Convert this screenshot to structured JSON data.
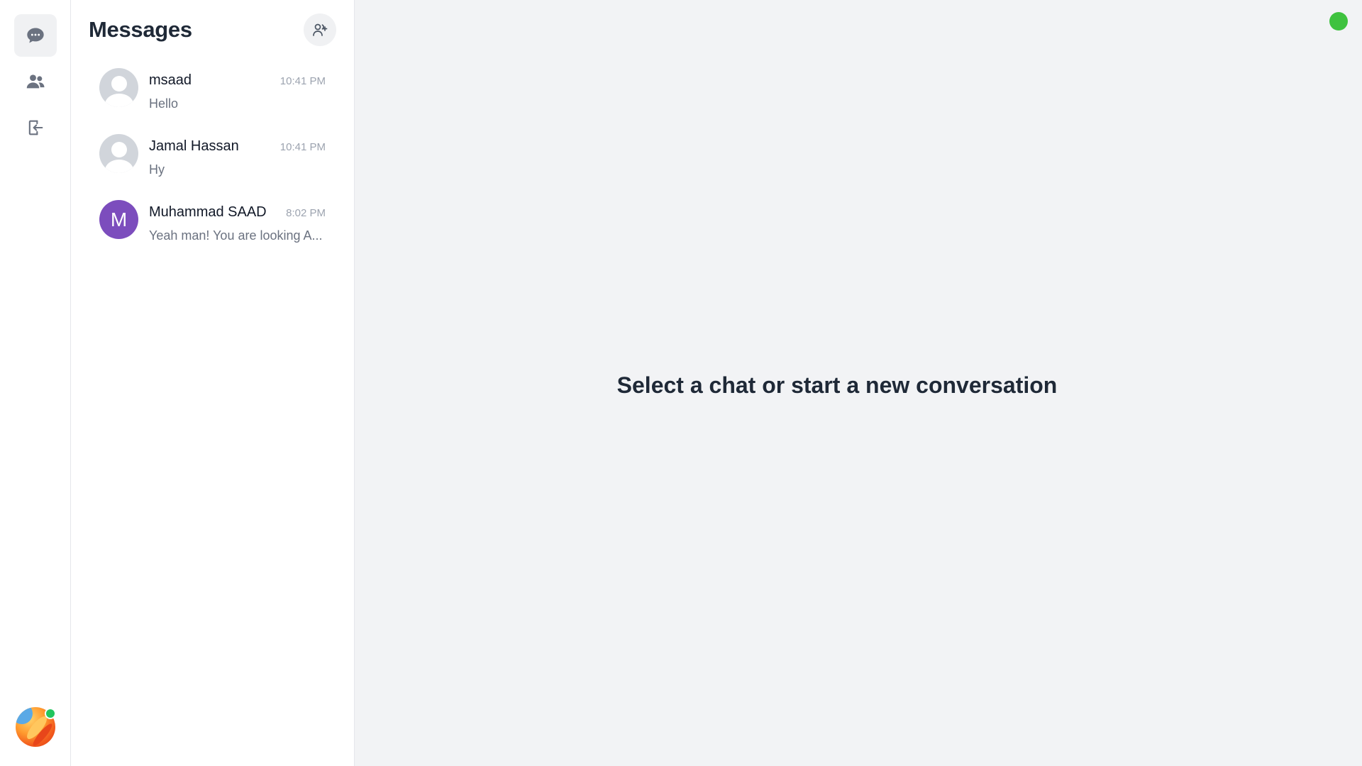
{
  "nav": {
    "items": [
      {
        "name": "chats",
        "icon": "chat-bubble-icon",
        "active": true
      },
      {
        "name": "contacts",
        "icon": "users-icon",
        "active": false
      },
      {
        "name": "logout",
        "icon": "logout-icon",
        "active": false
      }
    ],
    "user_status": "online"
  },
  "messages_panel": {
    "title": "Messages",
    "add_contact_icon": "user-plus-icon",
    "chats": [
      {
        "name": "msaad",
        "time": "10:41 PM",
        "preview": "Hello",
        "avatar": "default"
      },
      {
        "name": "Jamal Hassan",
        "time": "10:41 PM",
        "preview": "Hy",
        "avatar": "default"
      },
      {
        "name": "Muhammad SAAD",
        "time": "8:02 PM",
        "preview": "Yeah man! You are looking A...",
        "avatar": "letter",
        "avatar_letter": "M",
        "avatar_color": "#7c4dbd"
      }
    ]
  },
  "main": {
    "empty_message": "Select a chat or start a new conversation",
    "connection_status_color": "#3fc23f"
  }
}
